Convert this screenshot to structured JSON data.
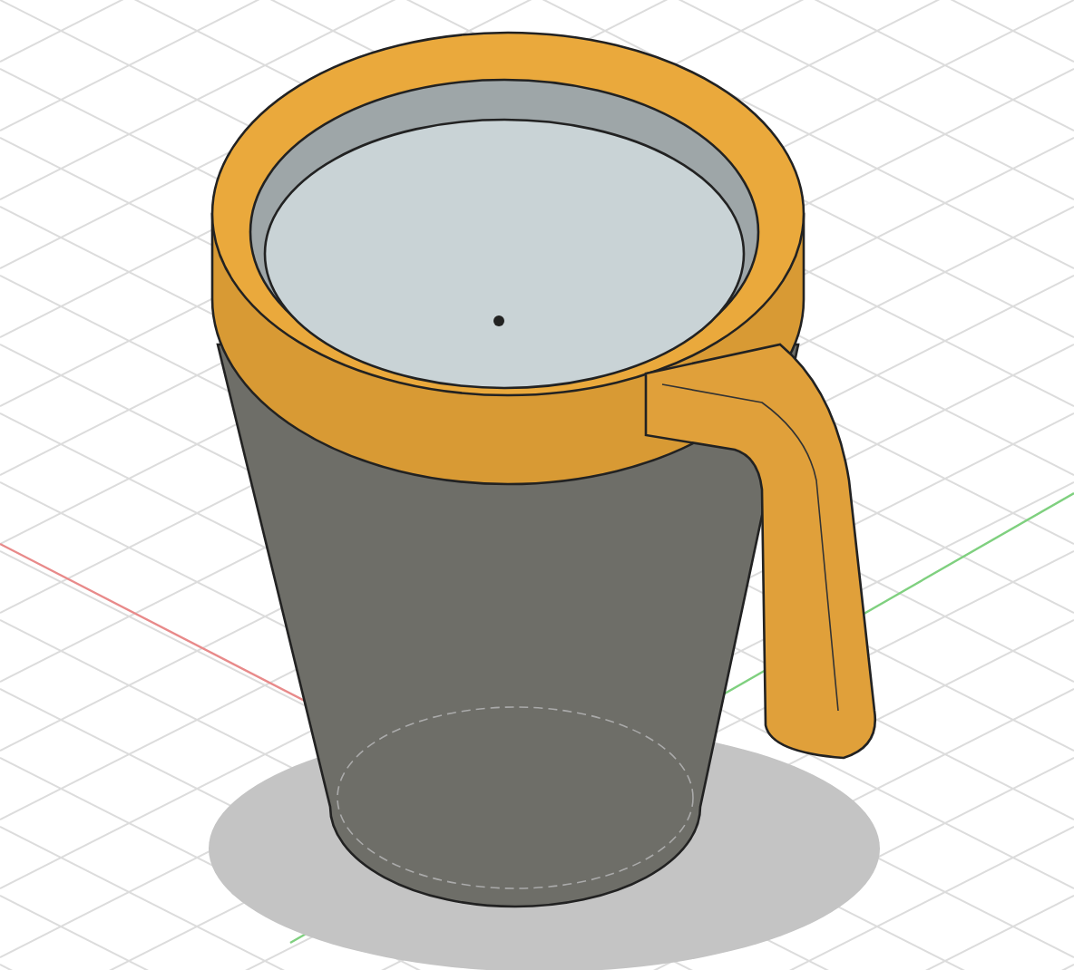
{
  "viewport": {
    "grid": true,
    "axes": [
      {
        "kind": "x",
        "color": "#e88a8a"
      },
      {
        "kind": "y",
        "color": "#7fd07f"
      }
    ]
  },
  "model": {
    "kind": "mug"
  }
}
